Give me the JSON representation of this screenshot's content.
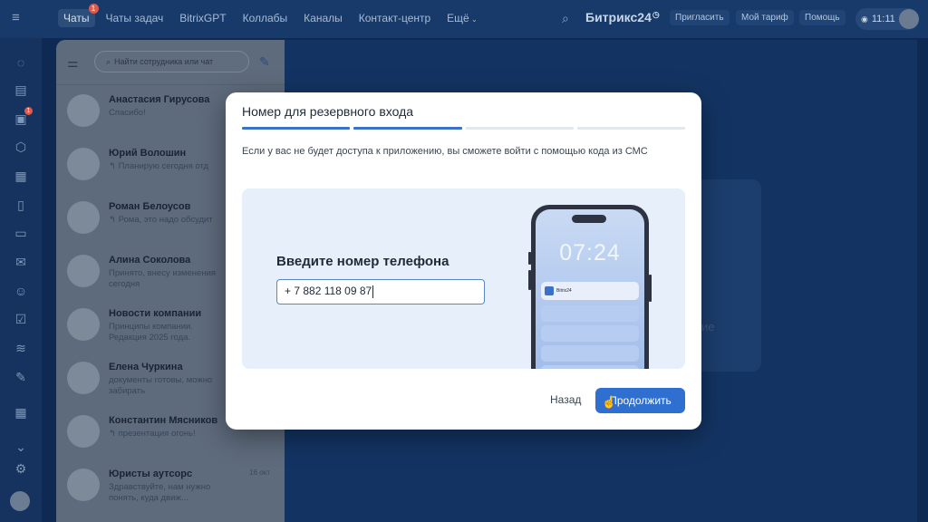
{
  "topbar": {
    "nav": [
      {
        "label": "Чаты",
        "badge": "1",
        "active": true
      },
      {
        "label": "Чаты задач"
      },
      {
        "label": "BitrixGPT"
      },
      {
        "label": "Коллабы"
      },
      {
        "label": "Каналы"
      },
      {
        "label": "Контакт-центр"
      },
      {
        "label": "Ещё"
      }
    ],
    "brand": "Битрикс24",
    "brand_mark": "◷",
    "invite": "Пригласить",
    "tariff": "Мой тариф",
    "help": "Помощь",
    "time": "11:11"
  },
  "rail": {
    "chat_badge": "1"
  },
  "chats": {
    "search_placeholder": "Найти сотрудника или чат",
    "items": [
      {
        "name": "Анастасия Гирусова",
        "preview": "Спасибо!",
        "date": ""
      },
      {
        "name": "Юрий Волошин",
        "preview": "↰ Планирую сегодня отд",
        "date": ""
      },
      {
        "name": "Роман Белоусов",
        "preview": "↰ Рома, это надо обсудит",
        "date": ""
      },
      {
        "name": "Алина Соколова",
        "preview": "Принято, внесу изменения сегодня",
        "date": ""
      },
      {
        "name": "Новости компании",
        "preview": "Принципы компании. Редакция 2025 года.",
        "date": ""
      },
      {
        "name": "Елена Чуркина",
        "preview": "документы готовы, можно забирать",
        "date": ""
      },
      {
        "name": "Константин Мясников",
        "preview": "↰ презентация огонь!",
        "date": ""
      },
      {
        "name": "Юристы аутсорс",
        "preview": "Здравствуйте, нам нужно понять, куда движ...",
        "date": "16 окт"
      }
    ]
  },
  "modal": {
    "title": "Номер для резервного входа",
    "steps_done": 2,
    "steps_total": 4,
    "description": "Если у вас не будет доступа к приложению, вы сможете войти с помощью кода из СМС",
    "illustration": {
      "heading": "Введите номер телефона",
      "phone_value": "+ 7 882 118 09 87",
      "phone_time": "07:24",
      "notification_app": "Bitrix24"
    },
    "back_label": "Назад",
    "continue_label": "Продолжить"
  },
  "background_text": "ие",
  "colors": {
    "accent": "#2f6fd0",
    "step_done": "#3a72c7",
    "badge": "#e05a4a"
  }
}
